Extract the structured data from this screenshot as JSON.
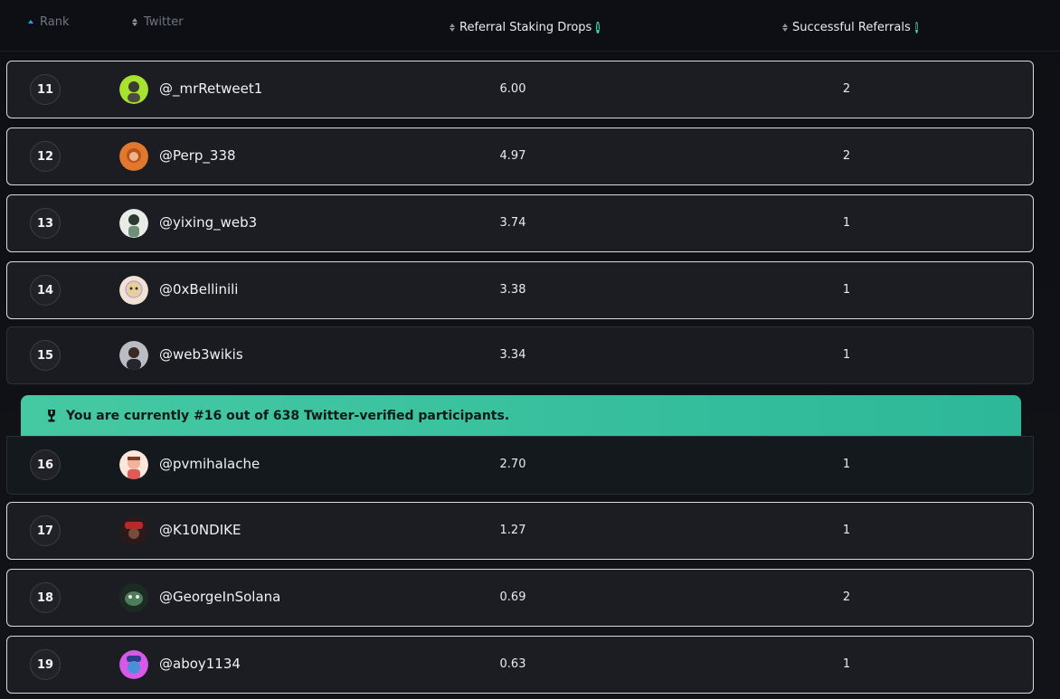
{
  "columns": {
    "rank": "Rank",
    "twitter": "Twitter",
    "drops": "Referral Staking Drops",
    "referrals": "Successful Referrals",
    "info_glyph": "i"
  },
  "banner": {
    "text": "You are currently #16 out of 638 Twitter-verified participants.",
    "icon": "trophy-icon"
  },
  "rows": [
    {
      "rank": "11",
      "handle": "@_mrRetweet1",
      "drops": "6.00",
      "referrals": "2",
      "avatar_color": "#a6e22e"
    },
    {
      "rank": "12",
      "handle": "@Perp_338",
      "drops": "4.97",
      "referrals": "2",
      "avatar_color": "#e0782e"
    },
    {
      "rank": "13",
      "handle": "@yixing_web3",
      "drops": "3.74",
      "referrals": "1",
      "avatar_color": "#cfd6cf"
    },
    {
      "rank": "14",
      "handle": "@0xBellinili",
      "drops": "3.38",
      "referrals": "1",
      "avatar_color": "#e9d7c3"
    },
    {
      "rank": "15",
      "handle": "@web3wikis",
      "drops": "3.34",
      "referrals": "1",
      "avatar_color": "#8f8f95"
    },
    {
      "rank": "16",
      "handle": "@pvmihalache",
      "drops": "2.70",
      "referrals": "1",
      "avatar_color": "#f2c0a8"
    },
    {
      "rank": "17",
      "handle": "@K10NDIKE",
      "drops": "1.27",
      "referrals": "1",
      "avatar_color": "#7a1f1f"
    },
    {
      "rank": "18",
      "handle": "@GeorgeInSolana",
      "drops": "0.69",
      "referrals": "2",
      "avatar_color": "#2f5a3e"
    },
    {
      "rank": "19",
      "handle": "@aboy1134",
      "drops": "0.63",
      "referrals": "1",
      "avatar_color": "#b247e8"
    }
  ]
}
